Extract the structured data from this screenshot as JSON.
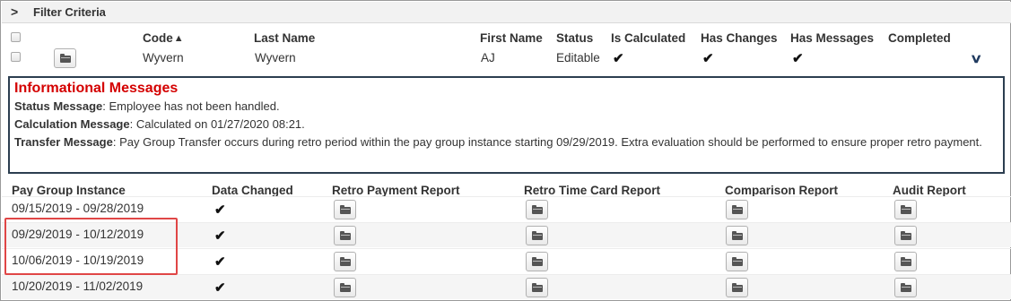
{
  "filter": {
    "title": "Filter Criteria",
    "chevron": "chevron-right-icon"
  },
  "employee_table": {
    "columns": {
      "code": "Code",
      "last_name": "Last Name",
      "first_name": "First Name",
      "status": "Status",
      "is_calculated": "Is Calculated",
      "has_changes": "Has Changes",
      "has_messages": "Has Messages",
      "completed": "Completed"
    },
    "sort_indicator": "^",
    "row": {
      "code": "Wyvern",
      "last_name": "Wyvern",
      "first_name": "AJ",
      "status": "Editable",
      "is_calculated": "✔",
      "has_changes": "✔",
      "has_messages": "✔",
      "expand": "chevron-down-icon"
    }
  },
  "messages": {
    "title": "Informational Messages",
    "status_label": "Status Message",
    "status_text": ": Employee has not been handled.",
    "calc_label": "Calculation Message",
    "calc_text": ": Calculated on 01/27/2020 08:21.",
    "transfer_label": "Transfer Message",
    "transfer_text": ": Pay Group Transfer occurs during retro period within the pay group instance starting 09/29/2019. Extra evaluation should be performed to ensure proper retro payment."
  },
  "pay_group_table": {
    "columns": {
      "instance": "Pay Group Instance",
      "data_changed": "Data Changed",
      "retro_payment": "Retro Payment Report",
      "retro_time_card": "Retro Time Card Report",
      "comparison": "Comparison Report",
      "audit": "Audit Report"
    },
    "rows": [
      {
        "instance": "09/15/2019 - 09/28/2019",
        "data_changed": "✔"
      },
      {
        "instance": "09/29/2019 - 10/12/2019",
        "data_changed": "✔"
      },
      {
        "instance": "10/06/2019 - 10/19/2019",
        "data_changed": "✔"
      },
      {
        "instance": "10/20/2019 - 11/02/2019",
        "data_changed": "✔"
      }
    ]
  },
  "colors": {
    "message_title": "#d40000",
    "highlight": "#e04646",
    "box_border": "#2c3e50"
  }
}
